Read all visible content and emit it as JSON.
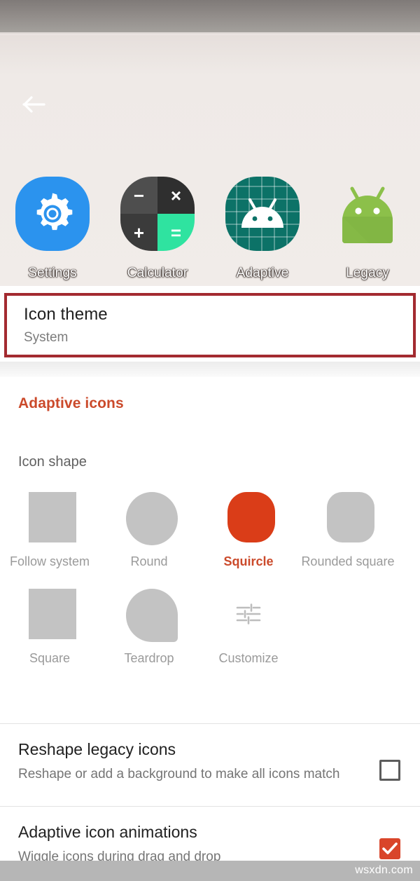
{
  "app": {
    "back_icon": "arrow-left-icon"
  },
  "preview": {
    "icons": [
      {
        "label": "Settings",
        "art": "settings-gear-icon"
      },
      {
        "label": "Calculator",
        "art": "calculator-icon",
        "keys": [
          "−",
          "×",
          "+",
          "="
        ]
      },
      {
        "label": "Adaptive",
        "art": "adaptive-android-icon"
      },
      {
        "label": "Legacy",
        "art": "legacy-android-icon"
      }
    ]
  },
  "icon_theme": {
    "title": "Icon theme",
    "value": "System",
    "highlight_color": "#a32a30"
  },
  "adaptive_section": {
    "header": "Adaptive icons",
    "accent_color": "#cb4a2b",
    "icon_shape": {
      "label": "Icon shape",
      "selected": "Squircle",
      "options": [
        {
          "name": "Follow system",
          "shape": "square",
          "selected": false
        },
        {
          "name": "Round",
          "shape": "circle",
          "selected": false
        },
        {
          "name": "Squircle",
          "shape": "squircle",
          "selected": true
        },
        {
          "name": "Rounded square",
          "shape": "rounded-square",
          "selected": false
        },
        {
          "name": "Square",
          "shape": "square",
          "selected": false
        },
        {
          "name": "Teardrop",
          "shape": "teardrop",
          "selected": false
        },
        {
          "name": "Customize",
          "shape": "tune-icon",
          "selected": false
        }
      ]
    },
    "preferences": [
      {
        "title": "Reshape legacy icons",
        "summary": "Reshape or add a background to make all icons match",
        "checked": false
      },
      {
        "title": "Adaptive icon animations",
        "summary": "Wiggle icons during drag and drop",
        "checked": true
      }
    ]
  },
  "watermark": {
    "text": "wsxdn.com"
  }
}
